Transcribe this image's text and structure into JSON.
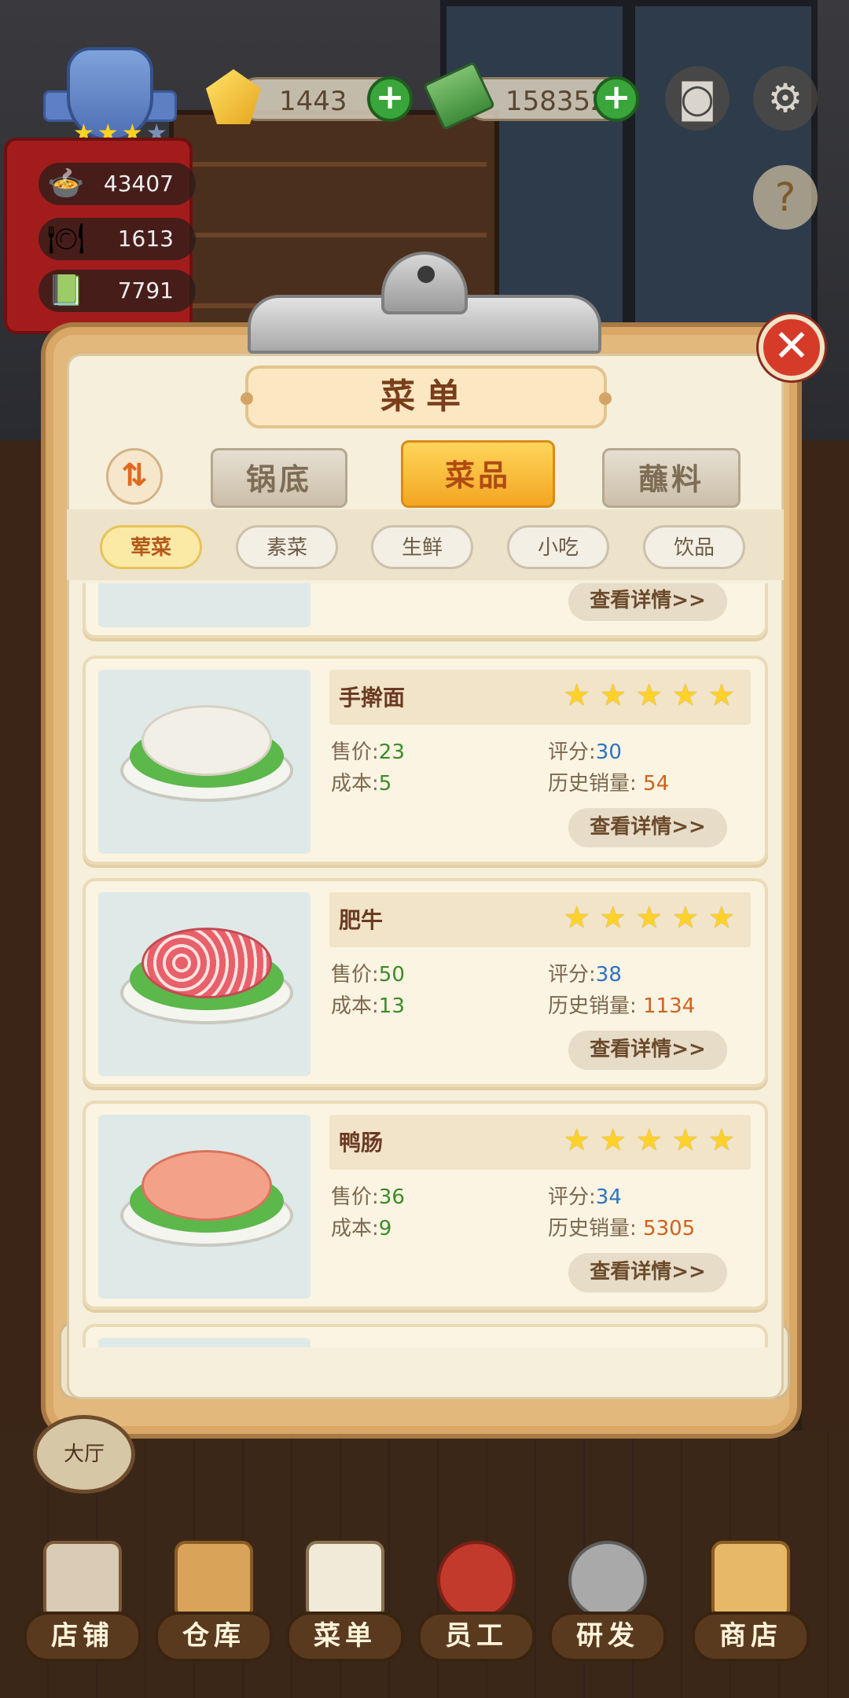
{
  "hud": {
    "gems": "1443",
    "cash": "158352",
    "stats": [
      "43407",
      "1613",
      "7791"
    ],
    "badge_stars_on": 3,
    "badge_stars_total": 4
  },
  "menu": {
    "title": "菜单",
    "sort_icon": "sort-arrows",
    "main_tabs": [
      "锅底",
      "菜品",
      "蘸料"
    ],
    "active_main_tab": "菜品",
    "sub_tabs": [
      "荤菜",
      "素菜",
      "生鲜",
      "小吃",
      "饮品"
    ],
    "active_sub_tab": "荤菜",
    "labels": {
      "price": "售价",
      "cost": "成本",
      "rating": "评分",
      "sales": "历史销量",
      "detail": "查看详情>>"
    },
    "dishes": [
      {
        "name": "手擀面",
        "stars": 5,
        "price": "23",
        "cost": "5",
        "rating": "30",
        "sales": "54",
        "food_color": "#f2efe6"
      },
      {
        "name": "肥牛",
        "stars": 5,
        "price": "50",
        "cost": "13",
        "rating": "38",
        "sales": "1134",
        "food_color": "#e8606a"
      },
      {
        "name": "鸭肠",
        "stars": 5,
        "price": "36",
        "cost": "9",
        "rating": "34",
        "sales": "5305",
        "food_color": "#f4a18a"
      }
    ]
  },
  "side": {
    "hall": "大厅"
  },
  "nav": [
    "店铺",
    "仓库",
    "菜单",
    "员工",
    "研发",
    "商店"
  ],
  "colors": {
    "accent": "#f3a622",
    "close": "#d63b2a",
    "plus": "#3aa53a"
  }
}
